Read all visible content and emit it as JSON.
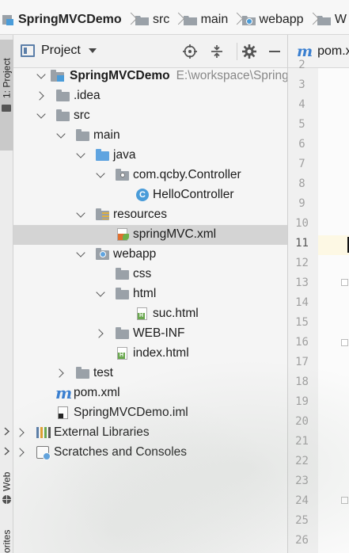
{
  "breadcrumb": {
    "items": [
      "SpringMVCDemo",
      "src",
      "main",
      "webapp",
      "W"
    ]
  },
  "left_strip": {
    "project_tab": "1: Project",
    "web_tab": "Web",
    "favorites_tab": "orites"
  },
  "panel": {
    "title": "Project"
  },
  "editor_tab": {
    "label": "pom.x"
  },
  "tree": [
    {
      "label": "SpringMVCDemo",
      "path": "E:\\workspace\\SpringM",
      "bold": true
    },
    {
      "label": ".idea"
    },
    {
      "label": "src"
    },
    {
      "label": "main"
    },
    {
      "label": "java"
    },
    {
      "label": "com.qcby.Controller"
    },
    {
      "label": "HelloController"
    },
    {
      "label": "resources"
    },
    {
      "label": "springMVC.xml"
    },
    {
      "label": "webapp"
    },
    {
      "label": "css"
    },
    {
      "label": "html"
    },
    {
      "label": "suc.html"
    },
    {
      "label": "WEB-INF"
    },
    {
      "label": "index.html"
    },
    {
      "label": "test"
    },
    {
      "label": "pom.xml"
    },
    {
      "label": "SpringMVCDemo.iml"
    },
    {
      "label": "External Libraries"
    },
    {
      "label": "Scratches and Consoles"
    }
  ],
  "line_numbers": [
    "2",
    "3",
    "4",
    "5",
    "6",
    "7",
    "8",
    "9",
    "10",
    "11",
    "12",
    "13",
    "14",
    "15",
    "16",
    "17",
    "18",
    "19",
    "20",
    "21",
    "22",
    "23",
    "24",
    "25",
    "26"
  ],
  "colors": {
    "accent": "#4a9cd9",
    "selection": "#d4d4d4",
    "html_badge": "#6aa84f"
  }
}
